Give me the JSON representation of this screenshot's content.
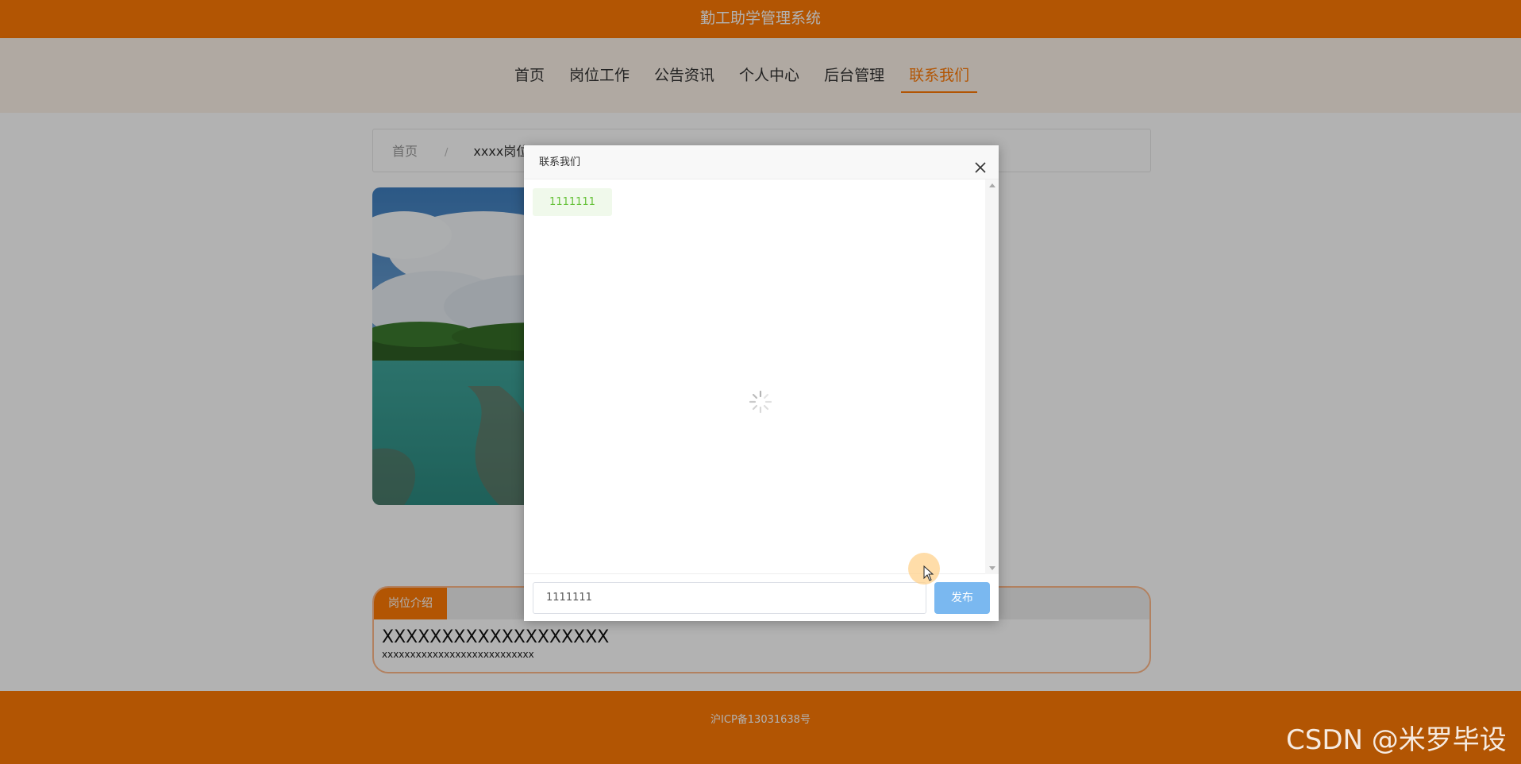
{
  "header": {
    "title": "勤工助学管理系统",
    "bg_color": "#ff7a05"
  },
  "nav": {
    "items": [
      {
        "label": "首页"
      },
      {
        "label": "岗位工作"
      },
      {
        "label": "公告资讯"
      },
      {
        "label": "个人中心"
      },
      {
        "label": "后台管理"
      },
      {
        "label": "联系我们",
        "active": true
      }
    ],
    "active_color": "#ff7a05"
  },
  "breadcrumb": {
    "home": "首页",
    "separator": "/",
    "current": "xxxx岗位"
  },
  "intro": {
    "tab_label": "岗位介绍",
    "heading": "XXXXXXXXXXXXXXXXXXX",
    "text": "xxxxxxxxxxxxxxxxxxxxxxxxxxx"
  },
  "footer": {
    "icp": "沪ICP备13031638号"
  },
  "dialog": {
    "title": "联系我们",
    "messages": [
      {
        "text": "1111111"
      }
    ],
    "input_value": "1111111",
    "send_label": "发布",
    "close_icon": "close-icon",
    "loading_icon": "spinner-icon"
  },
  "watermark": "CSDN @米罗毕设"
}
